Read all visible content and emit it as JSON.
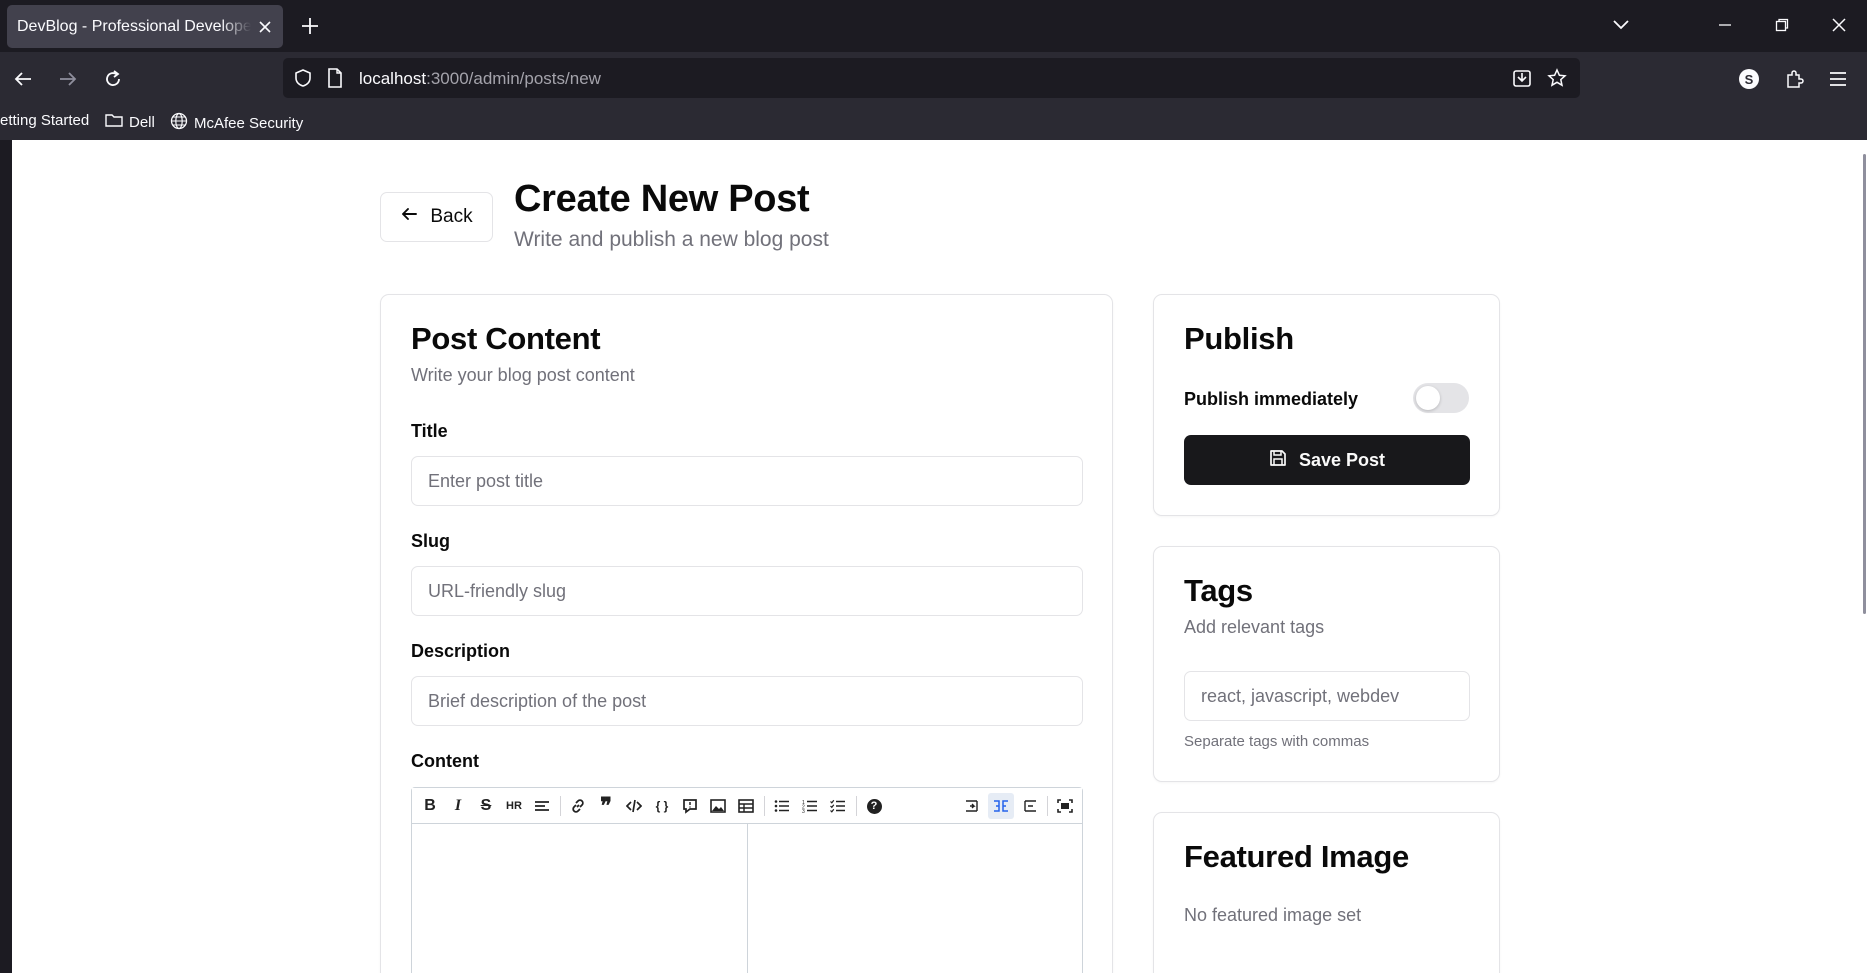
{
  "browser": {
    "tab_title": "DevBlog - Professional Developer Blog",
    "url_host": "localhost",
    "url_path": ":3000/admin/posts/new",
    "bookmarks": [
      {
        "label": "etting Started"
      },
      {
        "label": "Dell"
      },
      {
        "label": "McAfee Security"
      }
    ],
    "profile_initial": "S"
  },
  "header": {
    "back_label": "Back",
    "title": "Create New Post",
    "subtitle": "Write and publish a new blog post"
  },
  "post_content": {
    "title": "Post Content",
    "subtitle": "Write your blog post content",
    "fields": {
      "title_label": "Title",
      "title_placeholder": "Enter post title",
      "slug_label": "Slug",
      "slug_placeholder": "URL-friendly slug",
      "description_label": "Description",
      "description_placeholder": "Brief description of the post",
      "content_label": "Content"
    },
    "toolbar_icons": [
      "bold-icon",
      "italic-icon",
      "strikethrough-icon",
      "hr-icon",
      "title-icon",
      "link-icon",
      "quote-icon",
      "code-icon",
      "code-block-icon",
      "comment-icon",
      "image-icon",
      "table-icon",
      "unordered-list-icon",
      "ordered-list-icon",
      "checked-list-icon",
      "help-icon",
      "edit-mode-icon",
      "live-mode-icon",
      "preview-mode-icon",
      "fullscreen-icon"
    ]
  },
  "publish": {
    "title": "Publish",
    "toggle_label": "Publish immediately",
    "toggle_on": false,
    "save_label": "Save Post"
  },
  "tags": {
    "title": "Tags",
    "subtitle": "Add relevant tags",
    "placeholder": "react, javascript, webdev",
    "hint": "Separate tags with commas"
  },
  "featured_image": {
    "title": "Featured Image",
    "empty_text": "No featured image set"
  }
}
